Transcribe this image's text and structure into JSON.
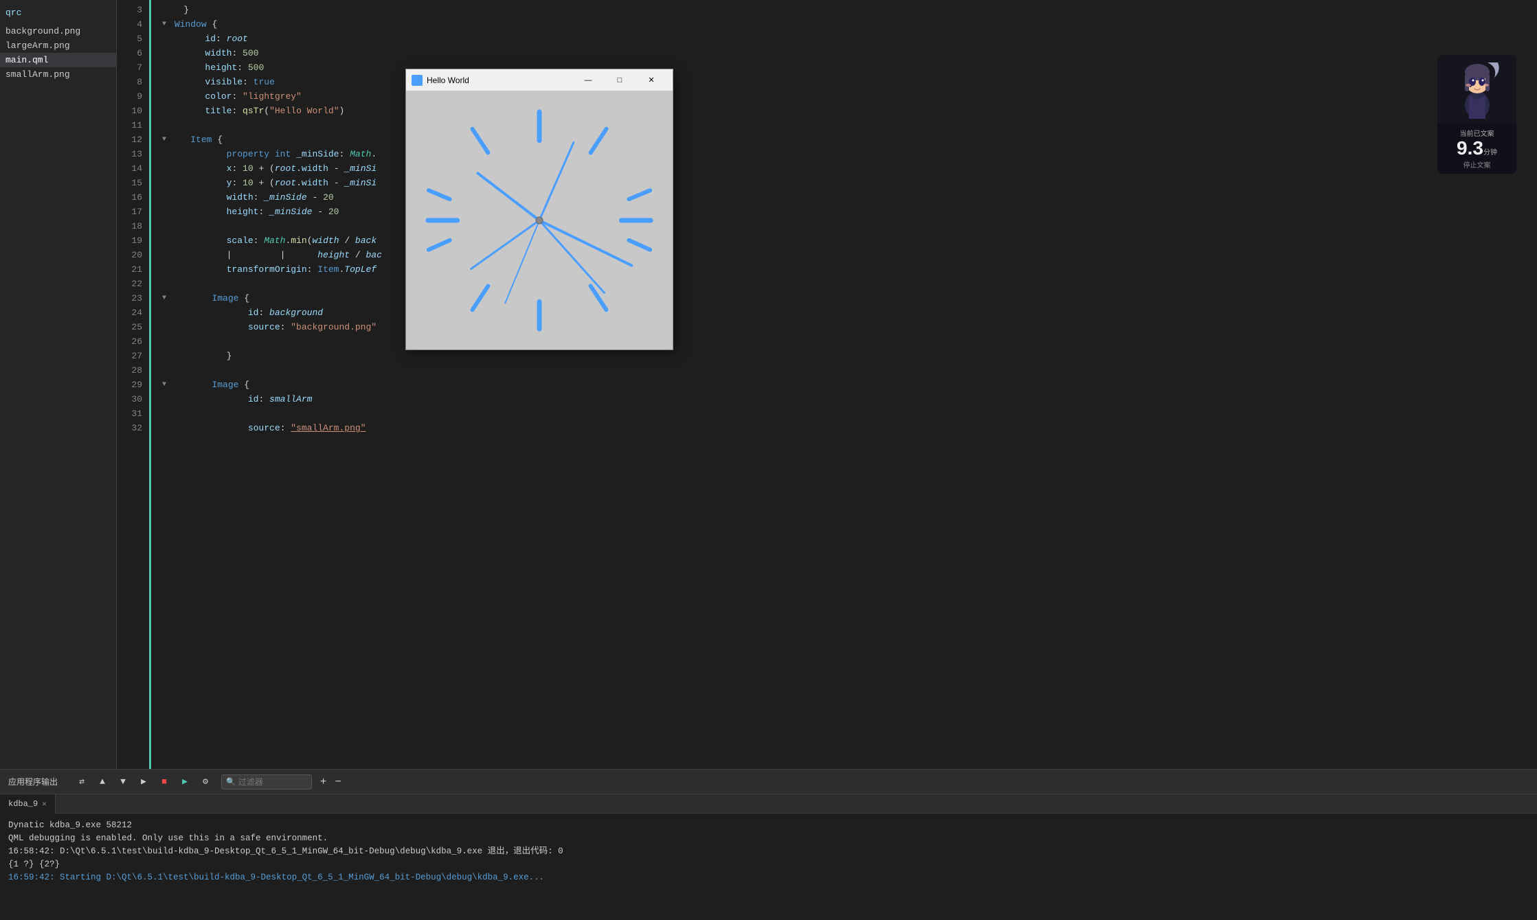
{
  "sidebar": {
    "items": [
      {
        "id": "qrc",
        "label": "qrc",
        "active": false
      },
      {
        "id": "background.png",
        "label": "background.png",
        "active": false
      },
      {
        "id": "largeArm.png",
        "label": "largeArm.png",
        "active": false
      },
      {
        "id": "main.qml",
        "label": "main.qml",
        "active": true
      },
      {
        "id": "smallArm.png",
        "label": "smallArm.png",
        "active": false
      }
    ]
  },
  "editor": {
    "lines": [
      {
        "num": 3,
        "content": "    }"
      },
      {
        "num": 4,
        "content": "▼  Window {"
      },
      {
        "num": 5,
        "content": "        id: root"
      },
      {
        "num": 6,
        "content": "        width: 500"
      },
      {
        "num": 7,
        "content": "        height: 500"
      },
      {
        "num": 8,
        "content": "        visible: true"
      },
      {
        "num": 9,
        "content": "        color: \"lightgrey\""
      },
      {
        "num": 10,
        "content": "        title: qsTr(\"Hello World\")"
      },
      {
        "num": 11,
        "content": ""
      },
      {
        "num": 12,
        "content": "▼      Item {"
      },
      {
        "num": 13,
        "content": "            property int _minSide: Math."
      },
      {
        "num": 14,
        "content": "            x: 10 + (root.width - _minSi"
      },
      {
        "num": 15,
        "content": "            y: 10 + (root.width - _minSi"
      },
      {
        "num": 16,
        "content": "            width: _minSide - 20"
      },
      {
        "num": 17,
        "content": "            height: _minSide - 20"
      },
      {
        "num": 18,
        "content": ""
      },
      {
        "num": 19,
        "content": "            scale: Math.min(width / back"
      },
      {
        "num": 20,
        "content": "            |         |      height / bac"
      },
      {
        "num": 21,
        "content": "            transformOrigin: Item.TopLef"
      },
      {
        "num": 22,
        "content": ""
      },
      {
        "num": 23,
        "content": "▼          Image {"
      },
      {
        "num": 24,
        "content": "                id: background"
      },
      {
        "num": 25,
        "content": "                source: \"background.png\""
      },
      {
        "num": 26,
        "content": ""
      },
      {
        "num": 27,
        "content": "            }"
      },
      {
        "num": 28,
        "content": ""
      },
      {
        "num": 29,
        "content": "▼          Image {"
      },
      {
        "num": 30,
        "content": "                id: smallArm"
      },
      {
        "num": 31,
        "content": ""
      },
      {
        "num": 32,
        "content": "                source: \"smallArm.png\""
      }
    ]
  },
  "hello_world_window": {
    "title": "Hello World",
    "min_label": "—",
    "max_label": "□",
    "close_label": "✕"
  },
  "anime_widget": {
    "header_label": "当前已文案",
    "time_value": "9.3",
    "time_unit": "分钟",
    "stop_label": "停止文案"
  },
  "bottom_panel": {
    "toolbar_label": "应用程序输出",
    "filter_placeholder": "过滤器",
    "tab_name": "kdba_9",
    "output_lines": [
      {
        "type": "plain",
        "text": "Dynatic kdba_9.exe 58212"
      },
      {
        "type": "plain",
        "text": "QML debugging is enabled. Only use this in a safe environment."
      },
      {
        "type": "path",
        "text": "16:58:42: D:\\Qt\\6.5.1\\test\\build-kdba_9-Desktop_Qt_6_5_1_MinGW_64_bit-Debug\\debug\\kdba_9.exe 退出，退出代码: 0"
      },
      {
        "type": "plain",
        "text": "{1 ?} {2?}"
      },
      {
        "type": "plain",
        "text": ""
      },
      {
        "type": "blue",
        "text": "16:59:42: Starting D:\\Qt\\6.5.1\\test\\build-kdba_9-Desktop_Qt_6_5_1_MinGW_64_bit-Debug\\debug\\kdba_9.exe..."
      }
    ]
  }
}
